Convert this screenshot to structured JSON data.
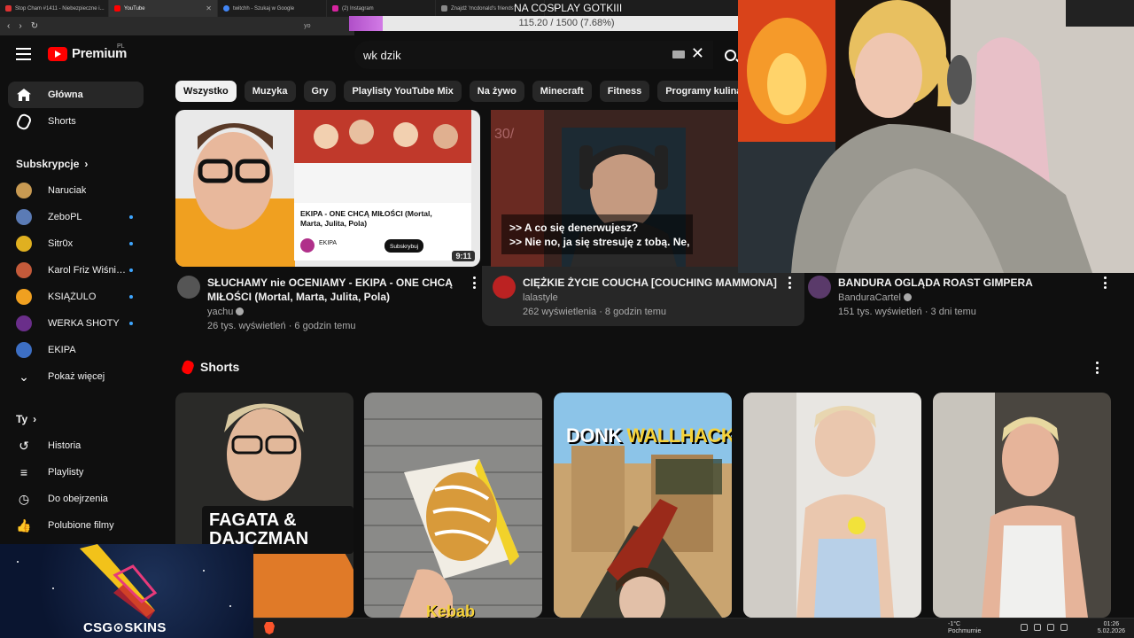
{
  "browser": {
    "tabs": [
      {
        "label": "Stop Cham #1411 - Niebezpieczne i...",
        "color": "#d33"
      },
      {
        "label": "YouTube",
        "color": "#f00",
        "active": true
      },
      {
        "label": "twitchh - Szukaj w Google",
        "color": "#4285f4"
      },
      {
        "label": "(2) Instagram",
        "color": "#d6249f"
      },
      {
        "label": "Znajdź 'mcdonald's friends'",
        "color": "#888"
      }
    ],
    "new_tab": "+",
    "address": "yo"
  },
  "stream_overlay": {
    "title": "NA COSPLAY GOTKIII",
    "progress_text": "115.20 / 1500 (7.68%)",
    "progress_fraction": 0.0768
  },
  "youtube": {
    "logo": "Premium",
    "logo_region": "PL",
    "search_value": "wk dzik",
    "chips": [
      "Wszystko",
      "Muzyka",
      "Gry",
      "Playlisty YouTube Mix",
      "Na żywo",
      "Minecraft",
      "Fitness",
      "Programy kulinarne"
    ],
    "sidebar": {
      "main": [
        {
          "label": "Główna",
          "icon": "home-icon",
          "active": true
        },
        {
          "label": "Shorts",
          "icon": "shorts-icon"
        }
      ],
      "subs_heading": "Subskrypcje",
      "subs": [
        {
          "label": "Naruciak",
          "color": "#c89a52",
          "dot": false
        },
        {
          "label": "ZeboPL",
          "color": "#5b7bb5",
          "dot": true
        },
        {
          "label": "Sitr0x",
          "color": "#e0b020",
          "dot": true
        },
        {
          "label": "Karol Friz Wiśnie...",
          "color": "#c45a3a",
          "dot": true
        },
        {
          "label": "KSIĄŻULO",
          "color": "#f0a020",
          "dot": true
        },
        {
          "label": "WERKA SHOTY",
          "color": "#6a2e8a",
          "dot": true
        },
        {
          "label": "EKIPA",
          "color": "#3d6fc4",
          "dot": false
        }
      ],
      "show_more": "Pokaż więcej",
      "you_heading": "Ty",
      "you_items": [
        {
          "label": "Historia",
          "icon": "history-icon",
          "glyph": "↺"
        },
        {
          "label": "Playlisty",
          "icon": "playlist-icon",
          "glyph": "≡"
        },
        {
          "label": "Do obejrzenia",
          "icon": "clock-icon",
          "glyph": "◷"
        },
        {
          "label": "Polubione filmy",
          "icon": "thumbs-up-icon",
          "glyph": "👍"
        }
      ]
    },
    "videos": [
      {
        "title_line1": "SŁUCHAMY nie OCENIAMY - EKIPA - ONE CHCĄ",
        "title_line2": "MIŁOŚCI (Mortal, Marta, Julita, Pola)",
        "channel": "yachu",
        "meta": "26 tys. wyświetleń · 6 godzin temu",
        "duration": "9:11",
        "inner_title": "EKIPA - ONE CHCĄ MIŁOŚCI (Mortal, Marta, Julita, Pola)",
        "inner_sub": "Subskrybuj",
        "inner_channel": "EKIPA"
      },
      {
        "title_line1": "CIĘŻKIE ŻYCIE COUCHA [COUCHING MAMMONA]",
        "channel": "lalastyle",
        "meta": "262 wyświetlenia · 8 godzin temu",
        "subtitle1": ">> A co się denerwujesz?",
        "subtitle2": ">> Nie no, ja się stresuję z tobą. Ne,"
      },
      {
        "title_line1": "BANDURA OGLĄDA ROAST GIMPERA",
        "channel": "BanduraCartel",
        "meta": "151 tys. wyświetleń · 3 dni temu"
      }
    ],
    "shorts_heading": "Shorts",
    "shorts": [
      {
        "overlay": "FAGATA & DAJCZMAN"
      },
      {
        "overlay": "Kebab"
      },
      {
        "overlay_white": "DONK ",
        "overlay_yellow": "WALLHACK?"
      },
      {},
      {}
    ]
  },
  "ad": {
    "brand": "CSG",
    "brand_rest": "SKINS"
  },
  "taskbar": {
    "weather_temp": "-1°C",
    "weather_desc": "Pochmurnie",
    "time": "01:26",
    "date": "5.02.2026"
  }
}
